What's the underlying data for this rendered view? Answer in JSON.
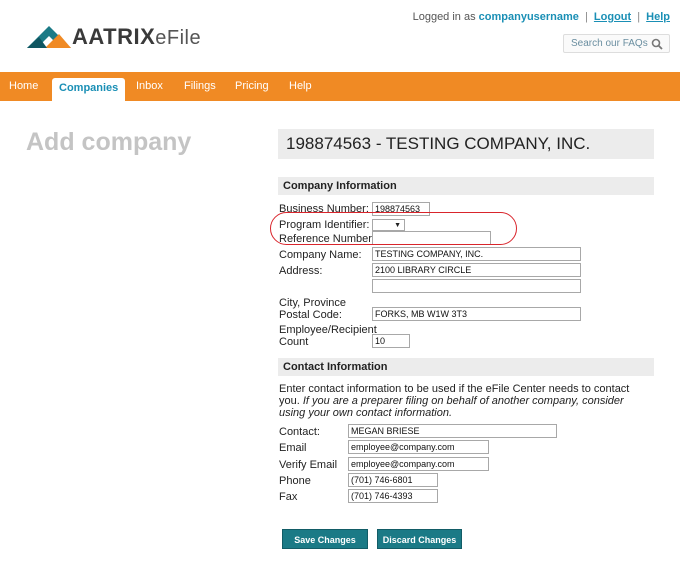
{
  "header": {
    "logo_bold": "AATRIX",
    "logo_light": "eFile",
    "logged_in_prefix": "Logged in as",
    "username": "companyusername",
    "logout": "Logout",
    "help": "Help",
    "search_placeholder": "Search our FAQs"
  },
  "nav": {
    "items": [
      "Home",
      "Companies",
      "Inbox",
      "Filings",
      "Pricing",
      "Help"
    ],
    "active": "Companies"
  },
  "page": {
    "title": "Add company",
    "company_header": "198874563 - TESTING COMPANY, INC."
  },
  "company_info": {
    "section_title": "Company Information",
    "business_number_label": "Business Number:",
    "business_number": "198874563",
    "program_identifier_label": "Program Identifier:",
    "program_identifier": "",
    "reference_number_label": "Reference Number:",
    "reference_number": "",
    "company_name_label": "Company Name:",
    "company_name": "TESTING COMPANY, INC.",
    "address_label": "Address:",
    "address1": "2100 LIBRARY CIRCLE",
    "address2": "",
    "city_label": "City, Province",
    "postal_label": "Postal Code:",
    "city_postal": "FORKS, MB W1W 3T3",
    "employee_label_1": "Employee/Recipient",
    "employee_label_2": "Count",
    "employee_count": "10"
  },
  "contact_info": {
    "section_title": "Contact Information",
    "note_plain": "Enter contact information to be used if the eFile Center needs to contact you.",
    "note_italic": "If you are a preparer filing on behalf of another company, consider using your own contact information.",
    "contact_label": "Contact:",
    "contact": "MEGAN BRIESE",
    "email_label": "Email",
    "email": "employee@company.com",
    "verify_email_label": "Verify Email",
    "verify_email": "employee@company.com",
    "phone_label": "Phone",
    "phone": "(701) 746-6801",
    "fax_label": "Fax",
    "fax": "(701) 746-4393"
  },
  "buttons": {
    "save": "Save Changes",
    "discard": "Discard Changes"
  },
  "colors": {
    "nav_orange": "#f08a24",
    "link_blue": "#1a8fb5",
    "button_teal": "#1b7a86",
    "callout_red": "#d9252c"
  }
}
